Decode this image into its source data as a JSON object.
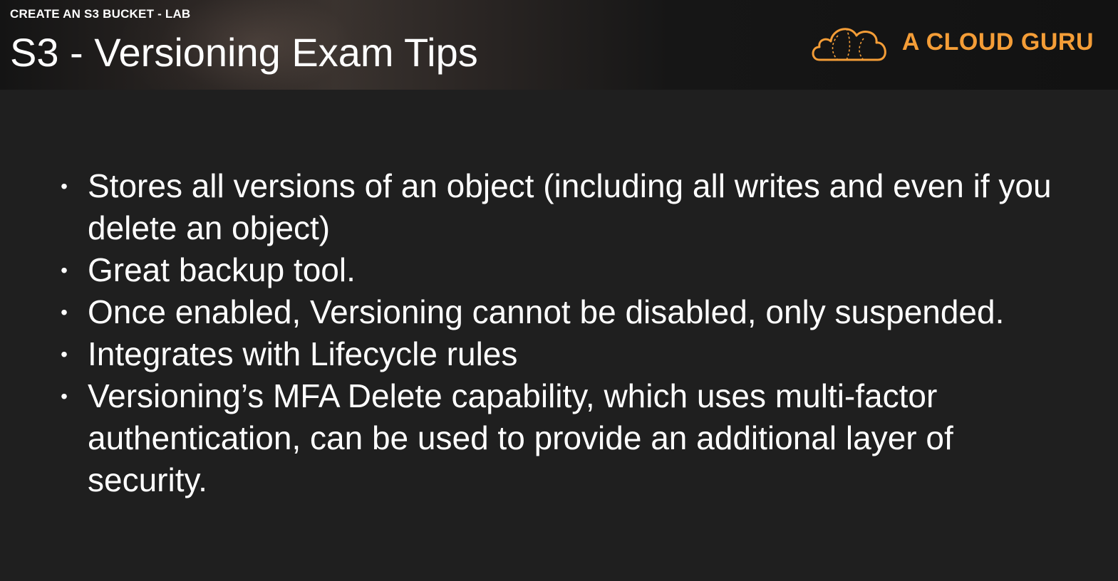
{
  "header": {
    "lab_label": "CREATE AN S3 BUCKET - LAB",
    "title": "S3 - Versioning Exam Tips",
    "brand_name": "A CLOUD GURU",
    "brand_icon": "cloud-logo-icon",
    "brand_color": "#f49d37"
  },
  "bullets": [
    {
      "text": "Stores all versions of an object (including all writes and even if you delete an object)"
    },
    {
      "text": "Great backup tool."
    },
    {
      "text": "Once enabled, Versioning cannot be disabled, only suspended."
    },
    {
      "text": "Integrates with Lifecycle rules"
    },
    {
      "text": "Versioning’s MFA Delete capability, which uses multi-factor authentication, can be used to provide an additional layer of security."
    }
  ],
  "bullet_glyph": "•"
}
